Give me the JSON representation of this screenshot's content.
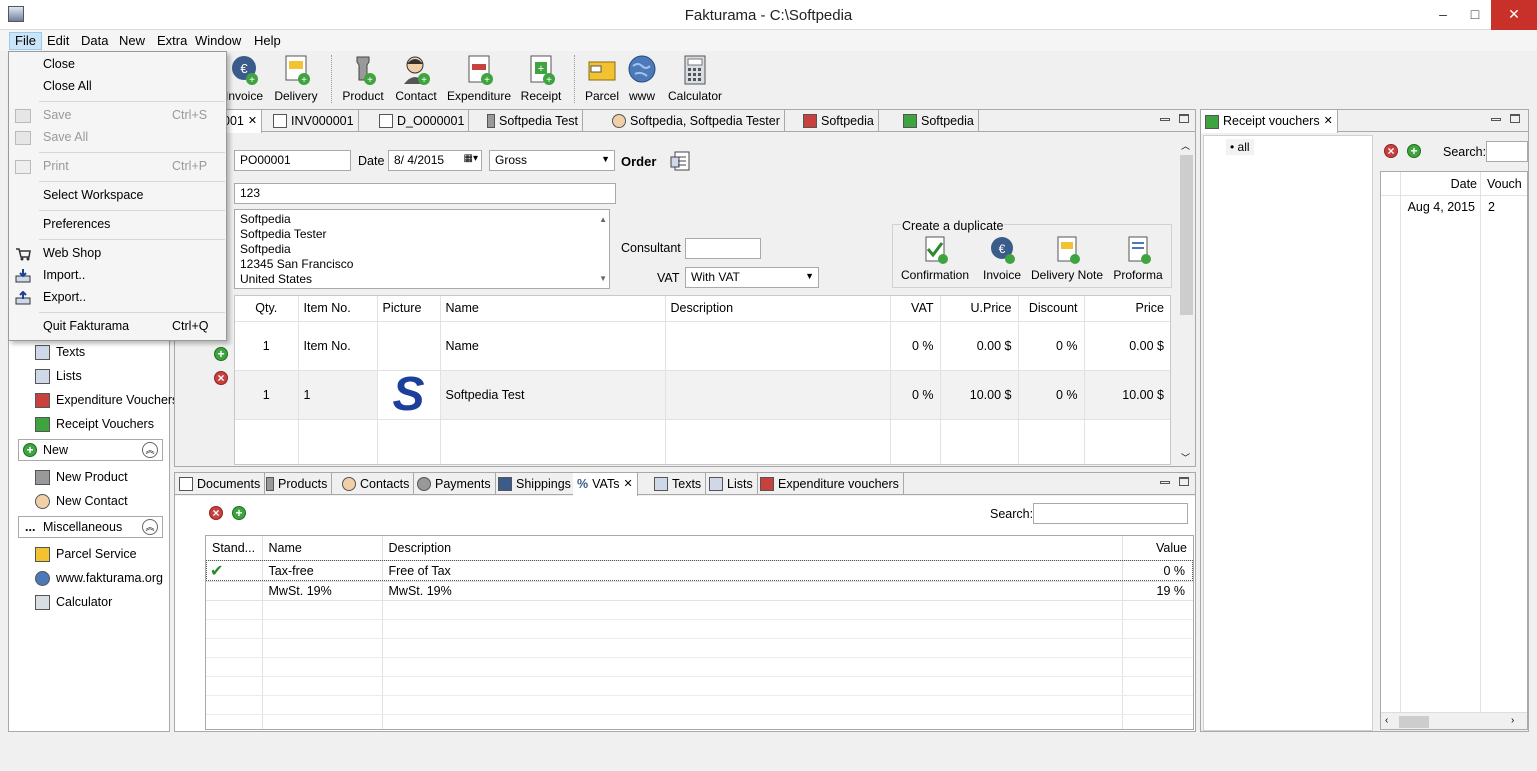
{
  "window": {
    "title": "Fakturama - C:\\Softpedia",
    "controls": [
      "–",
      "□",
      "✕"
    ]
  },
  "menubar": [
    "File",
    "Edit",
    "Data",
    "New",
    "Extra",
    "Window",
    "Help"
  ],
  "file_menu": {
    "close": "Close",
    "close_all": "Close All",
    "save": "Save",
    "save_sc": "Ctrl+S",
    "save_all": "Save All",
    "print": "Print",
    "print_sc": "Ctrl+P",
    "select_workspace": "Select Workspace",
    "preferences": "Preferences",
    "web_shop": "Web Shop",
    "import": "Import..",
    "export": "Export..",
    "quit": "Quit Fakturama",
    "quit_sc": "Ctrl+Q"
  },
  "toolbar": [
    "Invoice",
    "Delivery",
    "Product",
    "Contact",
    "Expenditure",
    "Receipt",
    "Parcel",
    "www",
    "Calculator"
  ],
  "editor_tabs": [
    "001",
    "INV000001",
    "D_O000001",
    "Softpedia Test",
    "Softpedia, Softpedia Tester",
    "Softpedia",
    "Softpedia"
  ],
  "order": {
    "number": "PO00001",
    "date_label": "Date",
    "date": "8/ 4/2015",
    "price_type": "Gross",
    "doc_type": "Order",
    "ref": "123",
    "address": [
      "Softpedia",
      "Softpedia Tester",
      "Softpedia",
      "12345 San Francisco",
      "United States"
    ],
    "consultant_label": "Consultant",
    "consultant": "",
    "vat_label": "VAT",
    "vat": "With VAT",
    "duplicate_label": "Create a duplicate",
    "duplicates": [
      "Confirmation",
      "Invoice",
      "Delivery Note",
      "Proforma"
    ]
  },
  "items": {
    "headers": [
      "Qty.",
      "Item No.",
      "Picture",
      "Name",
      "Description",
      "VAT",
      "U.Price",
      "Discount",
      "Price"
    ],
    "rows": [
      [
        "1",
        "Item No.",
        "",
        "Name",
        "",
        "0 %",
        "0.00 $",
        "0 %",
        "0.00 $"
      ],
      [
        "1",
        "1",
        "S",
        "Softpedia Test",
        "",
        "0 %",
        "10.00 $",
        "0 %",
        "10.00 $"
      ]
    ]
  },
  "nav": {
    "items_top": [
      "Texts",
      "Lists",
      "Expenditure Vouchers",
      "Receipt Vouchers"
    ],
    "section_new": "New",
    "items_new": [
      "New Product",
      "New Contact"
    ],
    "section_misc": "Miscellaneous",
    "items_misc": [
      "Parcel Service",
      "www.fakturama.org",
      "Calculator"
    ]
  },
  "bottom_tabs": [
    "Documents",
    "Products",
    "Contacts",
    "Payments",
    "Shippings",
    "VATs",
    "Texts",
    "Lists",
    "Expenditure vouchers"
  ],
  "vats": {
    "search_label": "Search:",
    "headers": [
      "Stand...",
      "Name",
      "Description",
      "Value"
    ],
    "rows": [
      [
        "✔",
        "Tax-free",
        "Free of Tax",
        "0 %"
      ],
      [
        "",
        "MwSt. 19%",
        "MwSt. 19%",
        "19 %"
      ]
    ]
  },
  "receipts": {
    "tab": "Receipt vouchers",
    "tree": "all",
    "search_label": "Search:",
    "headers": [
      "Date",
      "Vouch"
    ],
    "row": [
      "Aug 4, 2015",
      "2"
    ]
  },
  "colors": {
    "accent": "#cce4f7",
    "close_red": "#c7312a",
    "logo_blue": "#1b3f9a"
  }
}
